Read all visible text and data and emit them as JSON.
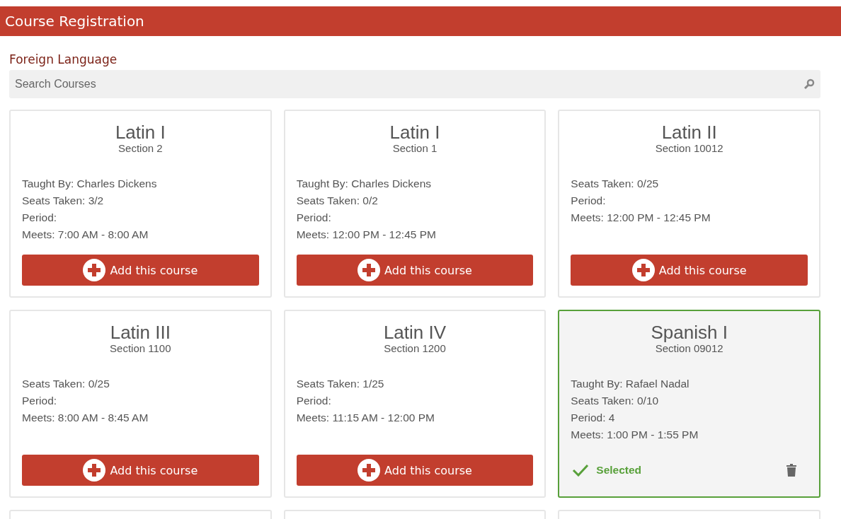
{
  "header": {
    "title": "Course Registration"
  },
  "category": "Foreign Language",
  "search": {
    "placeholder": "Search Courses"
  },
  "cards": [
    {
      "title": "Latin I",
      "section": "Section 2",
      "details": [
        "Taught By: Charles Dickens",
        "Seats Taken: 3/2",
        "Period:",
        "Meets: 7:00 AM - 8:00 AM"
      ],
      "selected": false,
      "action": "Add this course"
    },
    {
      "title": "Latin I",
      "section": "Section 1",
      "details": [
        "Taught By: Charles Dickens",
        "Seats Taken: 0/2",
        "Period:",
        "Meets: 12:00 PM - 12:45 PM"
      ],
      "selected": false,
      "action": "Add this course"
    },
    {
      "title": "Latin II",
      "section": "Section 10012",
      "details": [
        "Seats Taken: 0/25",
        "Period:",
        "Meets: 12:00 PM - 12:45 PM"
      ],
      "selected": false,
      "action": "Add this course"
    },
    {
      "title": "Latin III",
      "section": "Section 1100",
      "details": [
        "Seats Taken: 0/25",
        "Period:",
        "Meets: 8:00 AM - 8:45 AM"
      ],
      "selected": false,
      "action": "Add this course"
    },
    {
      "title": "Latin IV",
      "section": "Section 1200",
      "details": [
        "Seats Taken: 1/25",
        "Period:",
        "Meets: 11:15 AM - 12:00 PM"
      ],
      "selected": false,
      "action": "Add this course"
    },
    {
      "title": "Spanish I",
      "section": "Section 09012",
      "details": [
        "Taught By: Rafael Nadal",
        "Seats Taken: 0/10",
        "Period: 4",
        "Meets: 1:00 PM - 1:55 PM"
      ],
      "selected": true,
      "action": "Selected"
    }
  ]
}
